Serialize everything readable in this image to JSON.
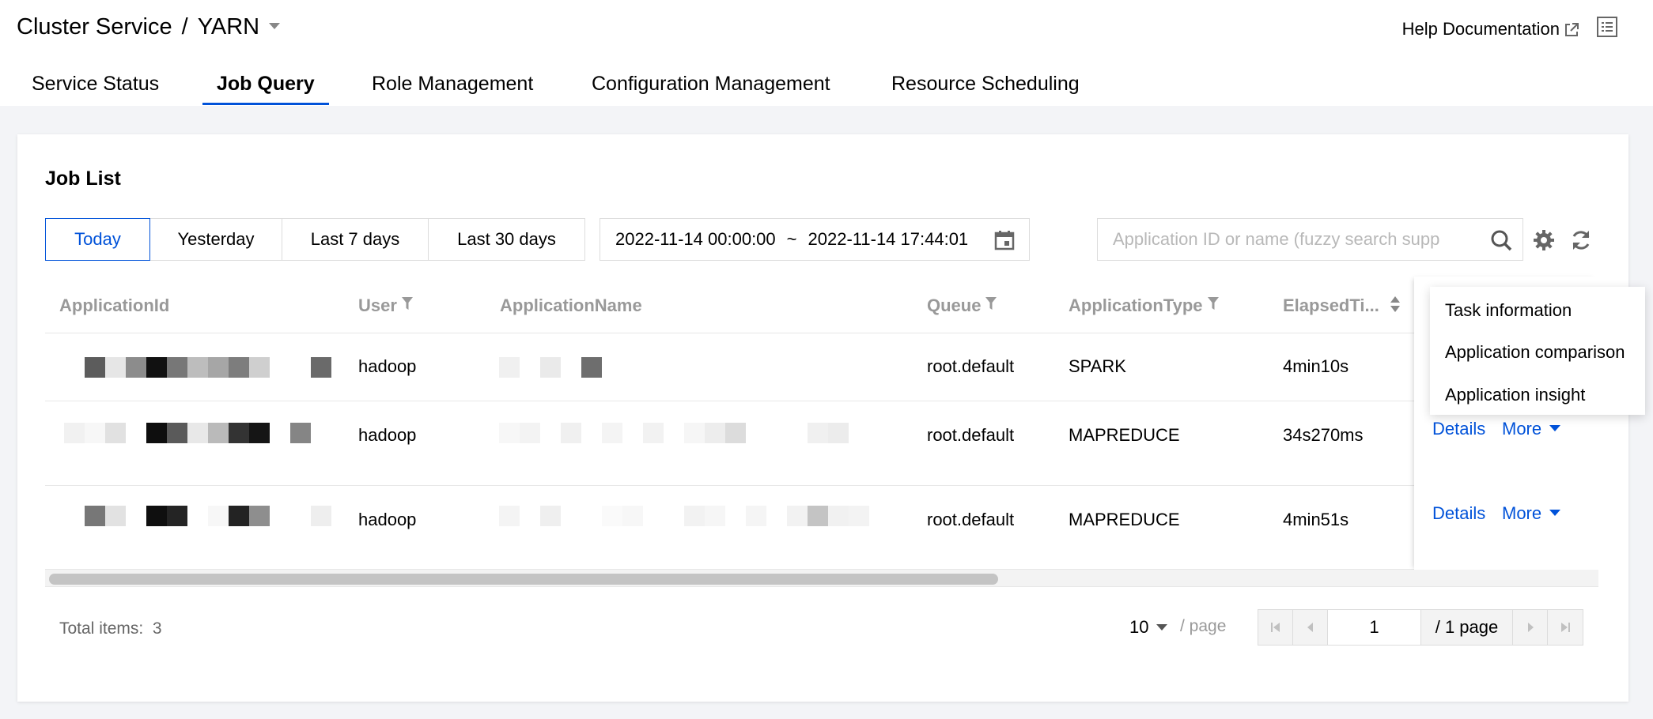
{
  "header": {
    "service": "Cluster Service",
    "separator": "/",
    "component": "YARN",
    "help_label": "Help Documentation"
  },
  "tabs": [
    {
      "label": "Service Status"
    },
    {
      "label": "Job Query"
    },
    {
      "label": "Role Management"
    },
    {
      "label": "Configuration Management"
    },
    {
      "label": "Resource Scheduling"
    }
  ],
  "active_tab": "Job Query",
  "job_list": {
    "title": "Job List",
    "range_buttons": [
      "Today",
      "Yesterday",
      "Last 7 days",
      "Last 30 days"
    ],
    "active_range": "Today",
    "date_start": "2022-11-14 00:00:00",
    "date_separator": "~",
    "date_end": "2022-11-14 17:44:01",
    "search_placeholder": "Application ID or name (fuzzy search supp"
  },
  "table": {
    "columns": [
      "ApplicationId",
      "User",
      "ApplicationName",
      "Queue",
      "ApplicationType",
      "ElapsedTi..."
    ],
    "rows": [
      {
        "user": "hadoop",
        "queue": "root.default",
        "type": "SPARK",
        "elapsed": "4min10s"
      },
      {
        "user": "hadoop",
        "queue": "root.default",
        "type": "MAPREDUCE",
        "elapsed": "34s270ms"
      },
      {
        "user": "hadoop",
        "queue": "root.default",
        "type": "MAPREDUCE",
        "elapsed": "4min51s"
      }
    ],
    "action_details": "Details",
    "action_more": "More"
  },
  "dropdown": [
    "Task information",
    "Application comparison",
    "Application insight"
  ],
  "pagination": {
    "total_label": "Total items:",
    "total": "3",
    "page_size": "10",
    "per_page_label": "/ page",
    "current_page": "1",
    "total_pages_label": "/ 1 page"
  },
  "colors": {
    "accent": "#0052d9",
    "header_text": "#999999",
    "background": "#f3f4f7"
  }
}
